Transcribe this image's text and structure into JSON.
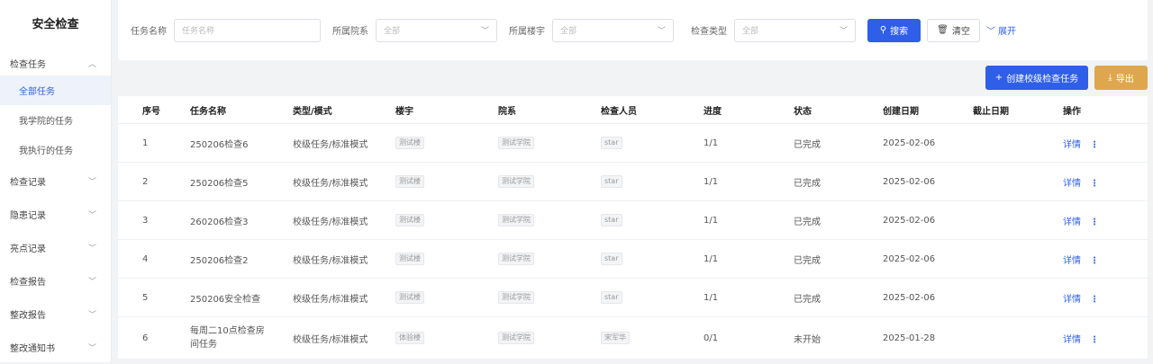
{
  "sidebar": {
    "title": "安全检查",
    "group_task": "检查任务",
    "sub_items": [
      "全部任务",
      "我学院的任务",
      "我执行的任务"
    ],
    "groups": [
      "检查记录",
      "隐患记录",
      "亮点记录",
      "检查报告",
      "整改报告",
      "整改通知书"
    ]
  },
  "filter": {
    "task_name_label": "任务名称",
    "task_name_placeholder": "任务名称",
    "college_label": "所属院系",
    "college_value": "全部",
    "building_label": "所属楼宇",
    "building_value": "全部",
    "type_label": "检查类型",
    "type_value": "全部",
    "search_label": "搜索",
    "clear_label": "清空",
    "expand_label": "展开"
  },
  "toolbar": {
    "create_label": "创建校级检查任务",
    "export_label": "导出"
  },
  "table": {
    "headers": [
      "序号",
      "任务名称",
      "类型/模式",
      "楼宇",
      "院系",
      "检查人员",
      "进度",
      "状态",
      "创建日期",
      "截止日期",
      "操作"
    ],
    "rows": [
      {
        "no": "1",
        "name": "250206检查6",
        "type": "校级任务/标准模式",
        "building": "测试楼",
        "college": "测试学院",
        "inspector": "star",
        "progress": "1/1",
        "status": "已完成",
        "created": "2025-02-06",
        "deadline": "",
        "action": "详情"
      },
      {
        "no": "2",
        "name": "250206检查5",
        "type": "校级任务/标准模式",
        "building": "测试楼",
        "college": "测试学院",
        "inspector": "star",
        "progress": "1/1",
        "status": "已完成",
        "created": "2025-02-06",
        "deadline": "",
        "action": "详情"
      },
      {
        "no": "3",
        "name": "260206检查3",
        "type": "校级任务/标准模式",
        "building": "测试楼",
        "college": "测试学院",
        "inspector": "star",
        "progress": "1/1",
        "status": "已完成",
        "created": "2025-02-06",
        "deadline": "",
        "action": "详情"
      },
      {
        "no": "4",
        "name": "250206检查2",
        "type": "校级任务/标准模式",
        "building": "测试楼",
        "college": "测试学院",
        "inspector": "star",
        "progress": "1/1",
        "status": "已完成",
        "created": "2025-02-06",
        "deadline": "",
        "action": "详情"
      },
      {
        "no": "5",
        "name": "250206安全检查",
        "type": "校级任务/标准模式",
        "building": "测试楼",
        "college": "测试学院",
        "inspector": "star",
        "progress": "1/1",
        "status": "已完成",
        "created": "2025-02-06",
        "deadline": "",
        "action": "详情"
      },
      {
        "no": "6",
        "name": "每周二10点检查房间任务",
        "type": "校级任务/标准模式",
        "building": "体验楼",
        "college": "测试学院",
        "inspector": "宋军华",
        "progress": "0/1",
        "status": "未开始",
        "created": "2025-01-28",
        "deadline": "",
        "action": "详情"
      }
    ]
  }
}
